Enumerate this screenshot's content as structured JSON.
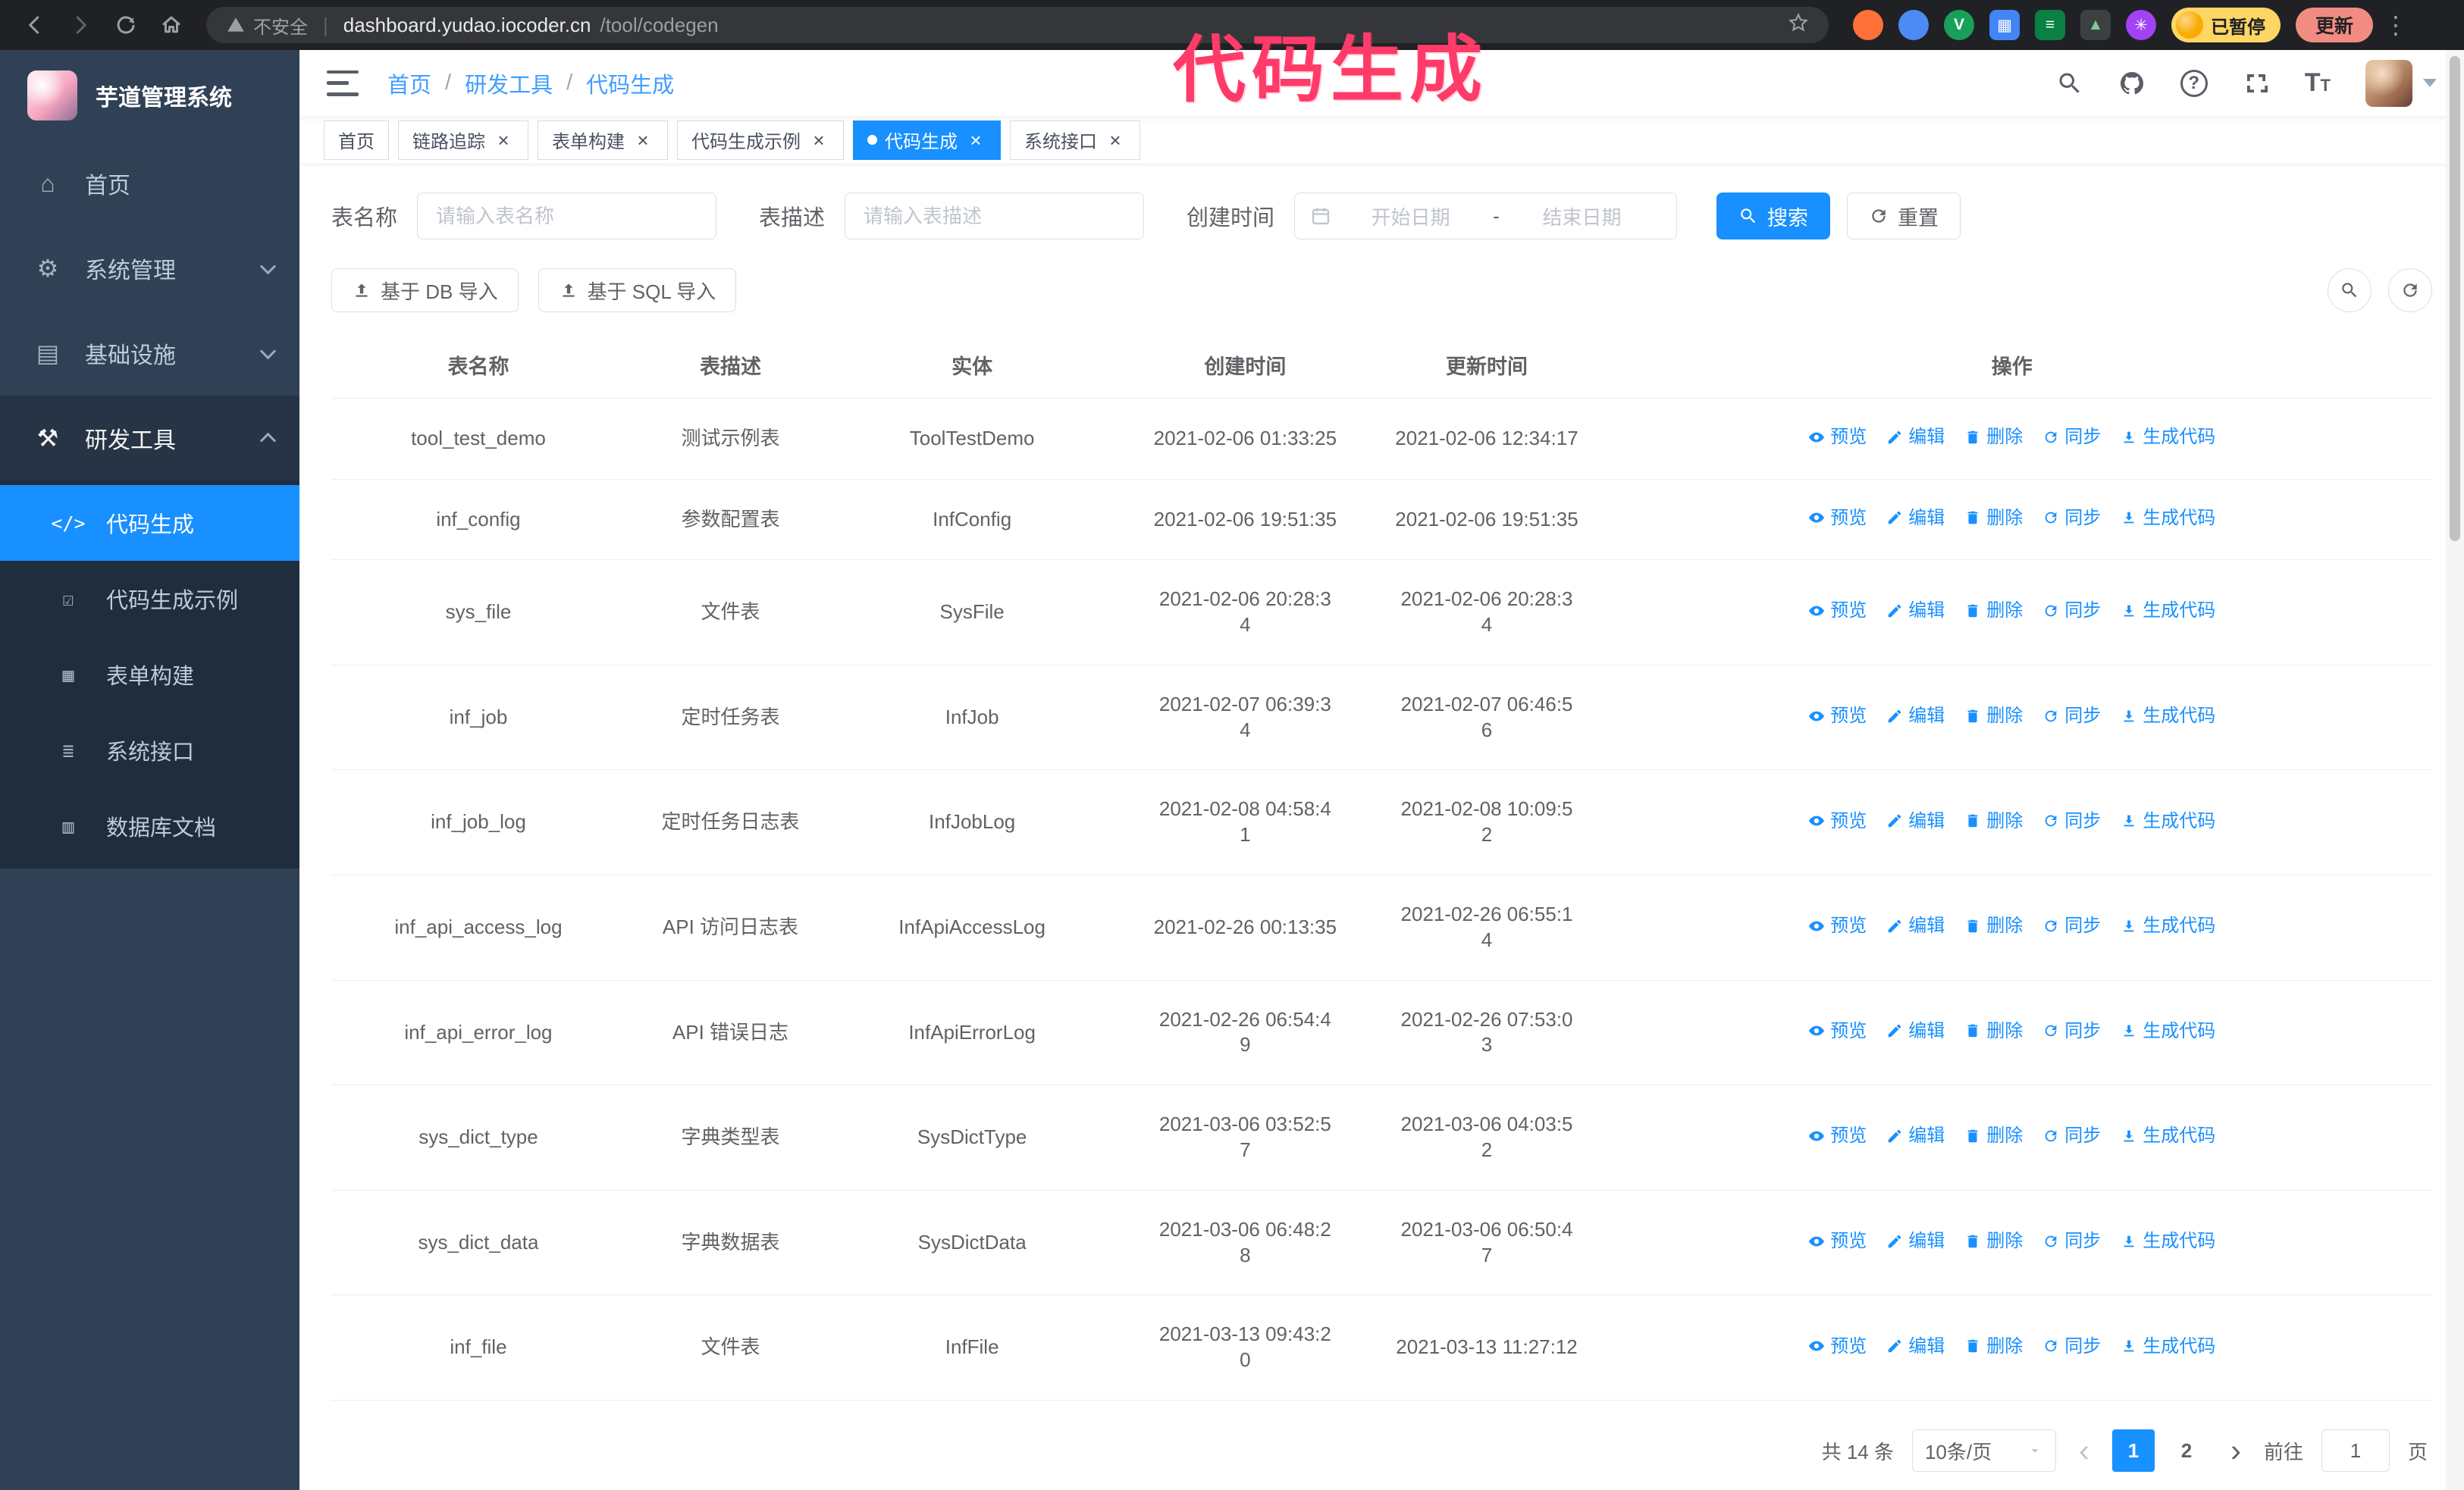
{
  "annotation": {
    "text": "代码生成",
    "color": "#ff3b69"
  },
  "colors": {
    "primary": "#1890ff",
    "sidebar_bg": "#304156",
    "submenu_bg": "#1f2d3d",
    "chrome_bg": "#202124"
  },
  "browser": {
    "security_label": "不安全",
    "url_host": "dashboard.yudao.iocoder.cn",
    "url_path": "/tool/codegen",
    "paused_badge": "已暂停",
    "update_button": "更新"
  },
  "sidebar": {
    "logo_title": "芋道管理系统",
    "menu": [
      {
        "id": "home",
        "label": "首页",
        "icon": "home-icon",
        "glyph": "⌂"
      },
      {
        "id": "system-admin",
        "label": "系统管理",
        "icon": "gear-icon",
        "glyph": "⚙",
        "chevron": "down"
      },
      {
        "id": "infrastructure",
        "label": "基础设施",
        "icon": "infra-icon",
        "glyph": "▤",
        "chevron": "down"
      },
      {
        "id": "dev-tools",
        "label": "研发工具",
        "icon": "tools-icon",
        "glyph": "⚒",
        "chevron": "up",
        "active": true,
        "children": [
          {
            "id": "codegen",
            "label": "代码生成",
            "icon": "code-icon",
            "glyph": "</>",
            "active": true
          },
          {
            "id": "codegen-example",
            "label": "代码生成示例",
            "icon": "badge-check-icon",
            "glyph": "☑"
          },
          {
            "id": "form-builder",
            "label": "表单构建",
            "icon": "form-icon",
            "glyph": "▦"
          },
          {
            "id": "system-api",
            "label": "系统接口",
            "icon": "api-icon",
            "glyph": "≣"
          },
          {
            "id": "db-doc",
            "label": "数据库文档",
            "icon": "database-icon",
            "glyph": "▥"
          }
        ]
      }
    ]
  },
  "breadcrumb": {
    "items": [
      "首页",
      "研发工具",
      "代码生成"
    ],
    "separator": "/"
  },
  "tabs": [
    {
      "label": "首页",
      "closable": false
    },
    {
      "label": "链路追踪",
      "closable": true
    },
    {
      "label": "表单构建",
      "closable": true
    },
    {
      "label": "代码生成示例",
      "closable": true
    },
    {
      "label": "代码生成",
      "closable": true,
      "active": true
    },
    {
      "label": "系统接口",
      "closable": true
    }
  ],
  "filters": {
    "table_name_label": "表名称",
    "table_name_placeholder": "请输入表名称",
    "table_desc_label": "表描述",
    "table_desc_placeholder": "请输入表描述",
    "create_time_label": "创建时间",
    "date_start_placeholder": "开始日期",
    "date_separator": "-",
    "date_end_placeholder": "结束日期",
    "search_button": "搜索",
    "reset_button": "重置"
  },
  "toolbar": {
    "import_db": "基于 DB 导入",
    "import_sql": "基于 SQL 导入"
  },
  "table": {
    "columns": [
      "表名称",
      "表描述",
      "实体",
      "创建时间",
      "更新时间",
      "操作"
    ],
    "actions": [
      "预览",
      "编辑",
      "删除",
      "同步",
      "生成代码"
    ],
    "rows": [
      {
        "name": "tool_test_demo",
        "desc": "测试示例表",
        "entity": "ToolTestDemo",
        "created": "2021-02-06 01:33:25",
        "updated": "2021-02-06 12:34:17"
      },
      {
        "name": "inf_config",
        "desc": "参数配置表",
        "entity": "InfConfig",
        "created": "2021-02-06 19:51:35",
        "updated": "2021-02-06 19:51:35"
      },
      {
        "name": "sys_file",
        "desc": "文件表",
        "entity": "SysFile",
        "created": "2021-02-06 20:28:3\n4",
        "updated": "2021-02-06 20:28:3\n4"
      },
      {
        "name": "inf_job",
        "desc": "定时任务表",
        "entity": "InfJob",
        "created": "2021-02-07 06:39:3\n4",
        "updated": "2021-02-07 06:46:5\n6"
      },
      {
        "name": "inf_job_log",
        "desc": "定时任务日志表",
        "entity": "InfJobLog",
        "created": "2021-02-08 04:58:4\n1",
        "updated": "2021-02-08 10:09:5\n2"
      },
      {
        "name": "inf_api_access_log",
        "desc": "API 访问日志表",
        "entity": "InfApiAccessLog",
        "created": "2021-02-26 00:13:35",
        "updated": "2021-02-26 06:55:1\n4"
      },
      {
        "name": "inf_api_error_log",
        "desc": "API 错误日志",
        "entity": "InfApiErrorLog",
        "created": "2021-02-26 06:54:4\n9",
        "updated": "2021-02-26 07:53:0\n3"
      },
      {
        "name": "sys_dict_type",
        "desc": "字典类型表",
        "entity": "SysDictType",
        "created": "2021-03-06 03:52:5\n7",
        "updated": "2021-03-06 04:03:5\n2"
      },
      {
        "name": "sys_dict_data",
        "desc": "字典数据表",
        "entity": "SysDictData",
        "created": "2021-03-06 06:48:2\n8",
        "updated": "2021-03-06 06:50:4\n7"
      },
      {
        "name": "inf_file",
        "desc": "文件表",
        "entity": "InfFile",
        "created": "2021-03-13 09:43:2\n0",
        "updated": "2021-03-13 11:27:12"
      }
    ]
  },
  "pagination": {
    "total_text": "共 14 条",
    "page_size_text": "10条/页",
    "pages": [
      "1",
      "2"
    ],
    "active_page": "1",
    "goto_label": "前往",
    "goto_value": "1",
    "goto_suffix": "页"
  }
}
